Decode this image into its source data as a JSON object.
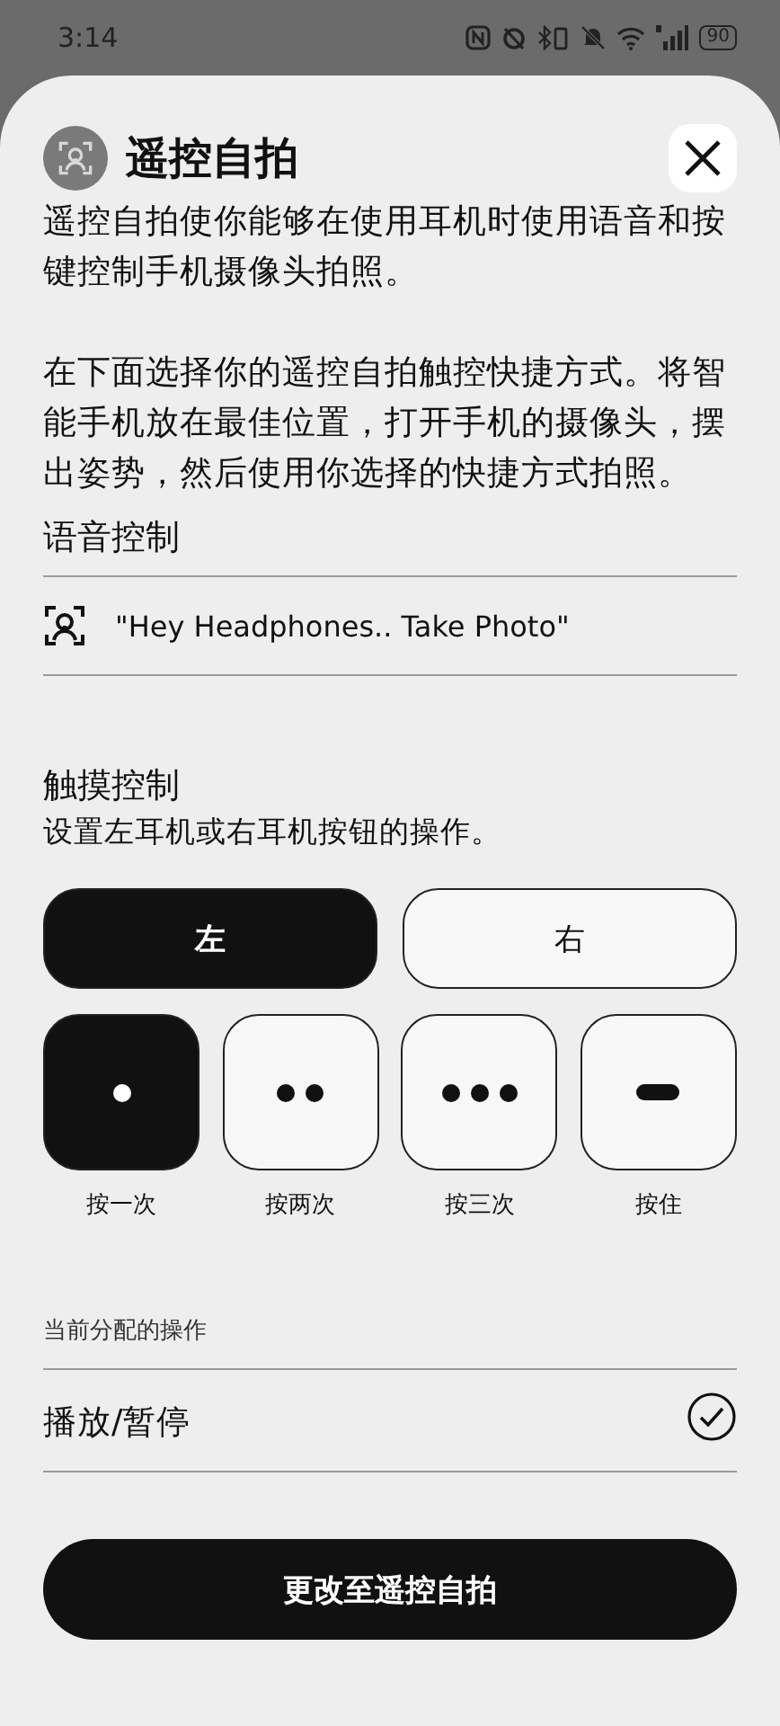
{
  "status_bar": {
    "time": "3:14",
    "battery": "90"
  },
  "sheet": {
    "title": "遥控自拍",
    "description": [
      "遥控自拍使你能够在使用耳机时使用语音和按键控制手机摄像头拍照。",
      "在下面选择你的遥控自拍触控快捷方式。将智能手机放在最佳位置，打开手机的摄像头，摆出姿势，然后使用你选择的快捷方式拍照。"
    ],
    "voice_control": {
      "heading": "语音控制",
      "command": "\"Hey Headphones.. Take Photo\""
    },
    "touch_control": {
      "heading": "触摸控制",
      "subtitle": "设置左耳机或右耳机按钮的操作。",
      "sides": [
        {
          "label": "左",
          "selected": true
        },
        {
          "label": "右",
          "selected": false
        }
      ],
      "gestures": [
        {
          "kind": "single",
          "label": "按一次",
          "selected": true
        },
        {
          "kind": "double",
          "label": "按两次",
          "selected": false
        },
        {
          "kind": "triple",
          "label": "按三次",
          "selected": false
        },
        {
          "kind": "hold",
          "label": "按住",
          "selected": false
        }
      ]
    },
    "current_action": {
      "heading": "当前分配的操作",
      "action": "播放/暂停",
      "checked": true
    },
    "button": "更改至遥控自拍"
  }
}
